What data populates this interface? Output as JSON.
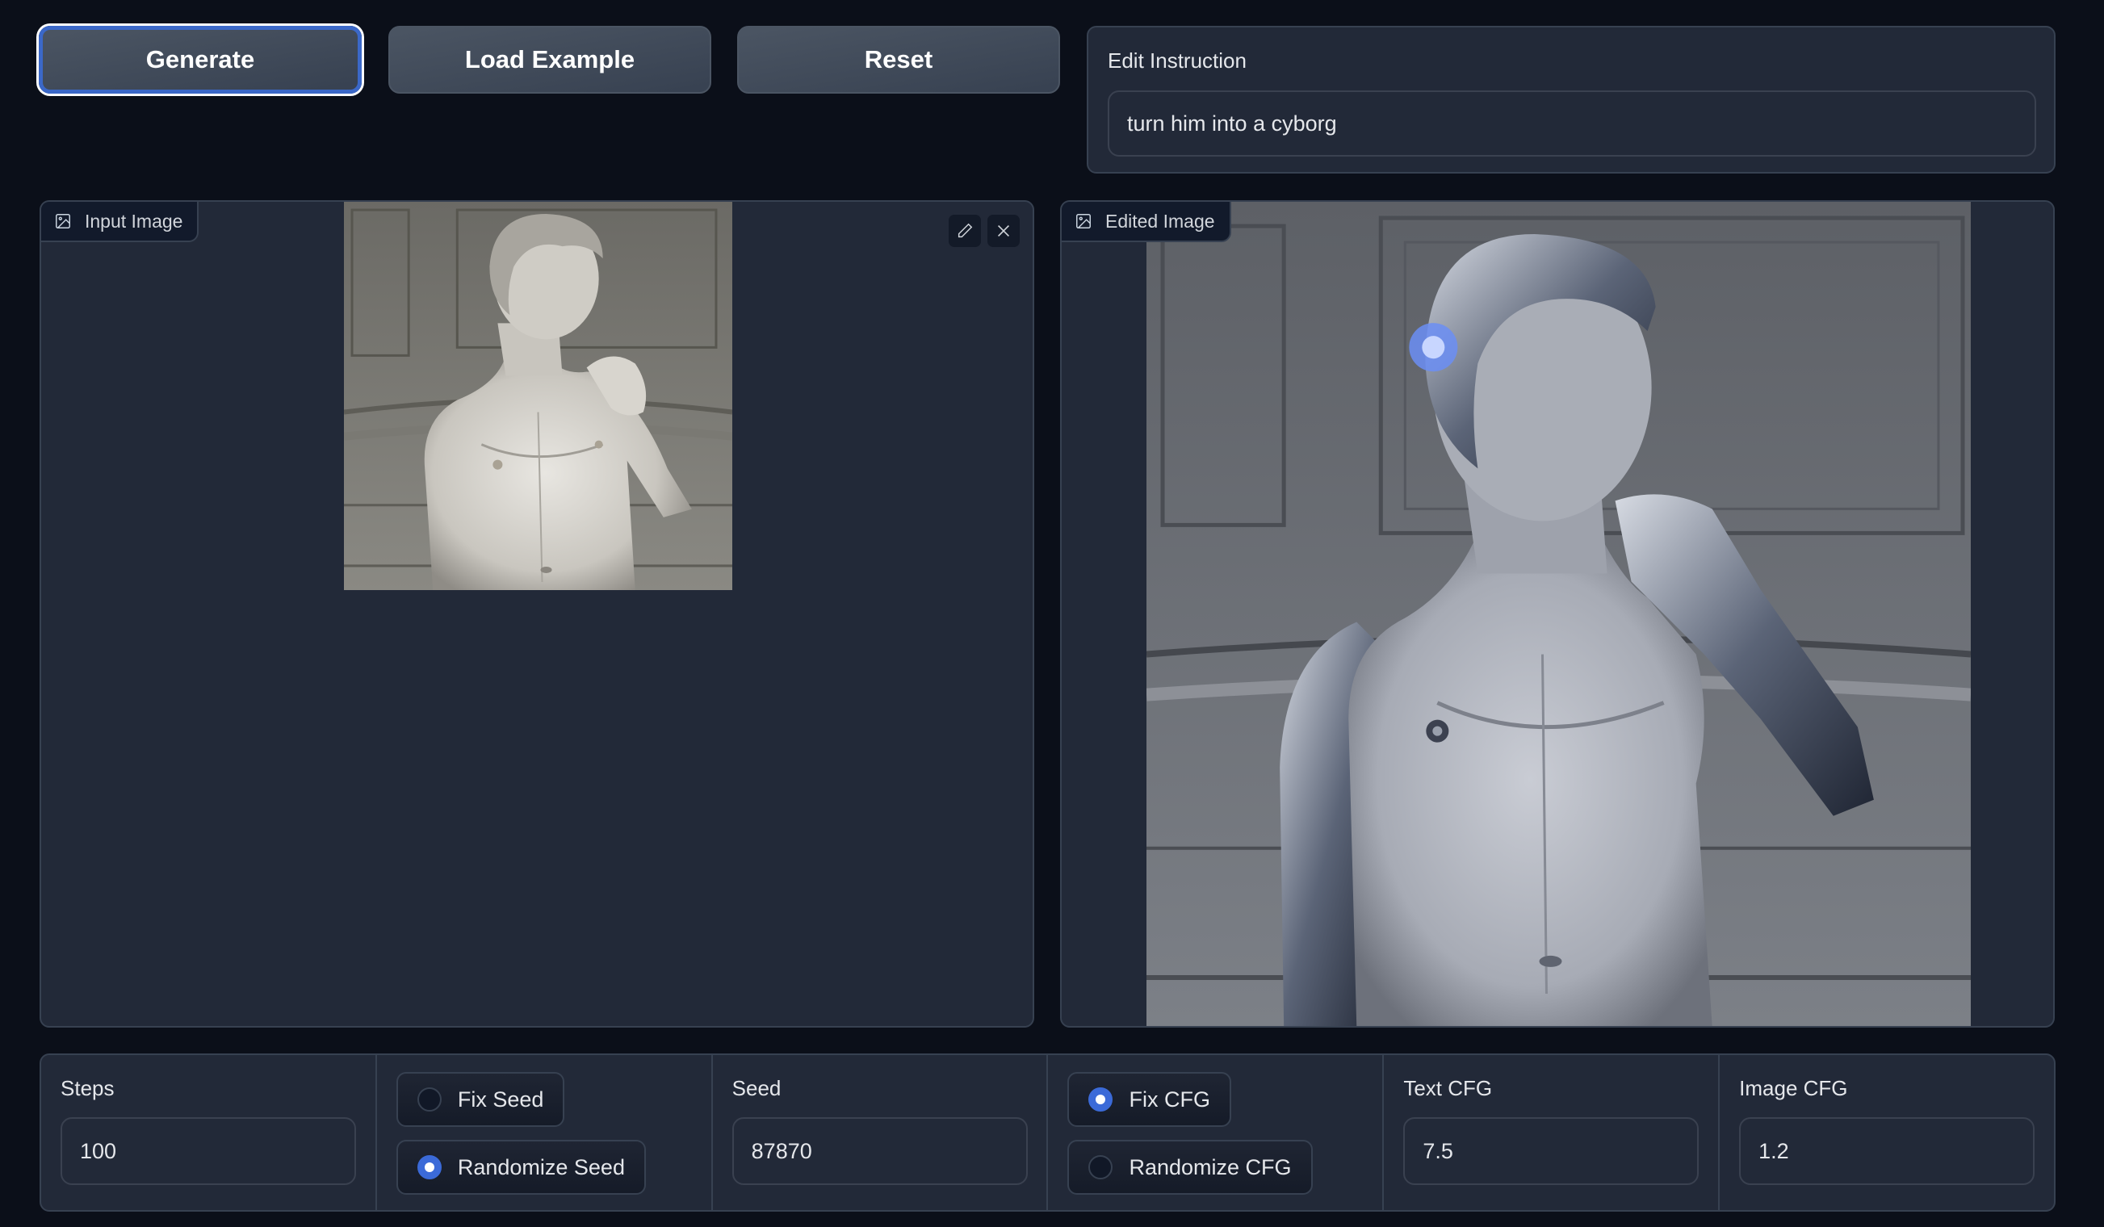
{
  "toolbar": {
    "generate_label": "Generate",
    "load_example_label": "Load Example",
    "reset_label": "Reset"
  },
  "instruction": {
    "label": "Edit Instruction",
    "value": "turn him into a cyborg"
  },
  "input_image": {
    "label": "Input Image",
    "icon": "image-icon",
    "edit_icon": "pencil-icon",
    "clear_icon": "close-icon",
    "alt": "Photo of Michelangelo's David statue (upper body)"
  },
  "edited_image": {
    "label": "Edited Image",
    "icon": "image-icon",
    "alt": "David statue edited into a cyborg with robotic arms and mechanical head"
  },
  "params": {
    "steps": {
      "label": "Steps",
      "value": "100"
    },
    "seed_mode": {
      "options": [
        {
          "label": "Fix Seed",
          "checked": false
        },
        {
          "label": "Randomize Seed",
          "checked": true
        }
      ]
    },
    "seed": {
      "label": "Seed",
      "value": "87870"
    },
    "cfg_mode": {
      "options": [
        {
          "label": "Fix CFG",
          "checked": true
        },
        {
          "label": "Randomize CFG",
          "checked": false
        }
      ]
    },
    "text_cfg": {
      "label": "Text CFG",
      "value": "7.5"
    },
    "image_cfg": {
      "label": "Image CFG",
      "value": "1.2"
    }
  },
  "colors": {
    "background": "#0b0f19",
    "panel": "#222938",
    "border": "#374151",
    "accent": "#3b6ad8",
    "button": "#4b5563"
  }
}
